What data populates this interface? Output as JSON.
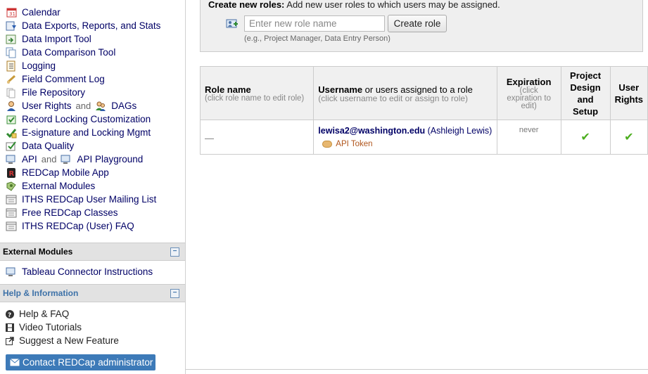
{
  "sidebar": {
    "items": [
      {
        "label": "Calendar",
        "icon": "calendar-icon"
      },
      {
        "label": "Data Exports, Reports, and Stats",
        "icon": "export-icon"
      },
      {
        "label": "Data Import Tool",
        "icon": "import-icon"
      },
      {
        "label": "Data Comparison Tool",
        "icon": "compare-icon"
      },
      {
        "label": "Logging",
        "icon": "logging-icon"
      },
      {
        "label": "Field Comment Log",
        "icon": "comment-icon"
      },
      {
        "label": "File Repository",
        "icon": "file-icon"
      },
      {
        "label": "User Rights",
        "and": "and",
        "label2": "DAGs",
        "icon": "user-icon"
      },
      {
        "label": "Record Locking Customization",
        "icon": "lock-icon"
      },
      {
        "label": "E-signature and Locking Mgmt",
        "icon": "esign-icon"
      },
      {
        "label": "Data Quality",
        "icon": "quality-icon"
      },
      {
        "label": "API",
        "and": "and",
        "label2": "API Playground",
        "icon": "api-icon"
      },
      {
        "label": "REDCap Mobile App",
        "icon": "mobile-icon"
      },
      {
        "label": "External Modules",
        "icon": "modules-icon"
      },
      {
        "label": "ITHS REDCap User Mailing List",
        "icon": "link-icon"
      },
      {
        "label": "Free REDCap Classes",
        "icon": "link-icon"
      },
      {
        "label": "ITHS REDCap (User) FAQ",
        "icon": "link-icon"
      }
    ],
    "external_modules": {
      "title": "External Modules",
      "items": [
        {
          "label": "Tableau Connector Instructions"
        }
      ]
    },
    "help": {
      "title": "Help & Information",
      "items": [
        {
          "label": "Help & FAQ"
        },
        {
          "label": "Video Tutorials"
        },
        {
          "label": "Suggest a New Feature"
        }
      ]
    },
    "contact_label": "Contact REDCap administrator"
  },
  "create": {
    "title": "Create new roles:",
    "desc": "Add new user roles to which users may be assigned.",
    "placeholder": "Enter new role name",
    "button": "Create role",
    "example": "(e.g., Project Manager, Data Entry Person)"
  },
  "table": {
    "headers": {
      "role_name": "Role name",
      "role_name_sub": "(click role name to edit role)",
      "username_bold": "Username",
      "username_rest": "or users assigned to a role",
      "username_sub": "(click username to edit or assign to role)",
      "expiration": "Expiration",
      "expiration_sub": "(click expiration to edit)",
      "project_design": "Project Design and Setup",
      "user_rights": "User Rights"
    },
    "rows": [
      {
        "role": "—",
        "username": "lewisa2@washington.edu",
        "fullname": "(Ashleigh Lewis)",
        "token": "API Token",
        "expiration": "never",
        "project_design": "✔",
        "user_rights": "✔"
      }
    ]
  },
  "colors": {
    "accent": "#3d7ab8",
    "link": "#000066",
    "check": "#4cae1f"
  }
}
